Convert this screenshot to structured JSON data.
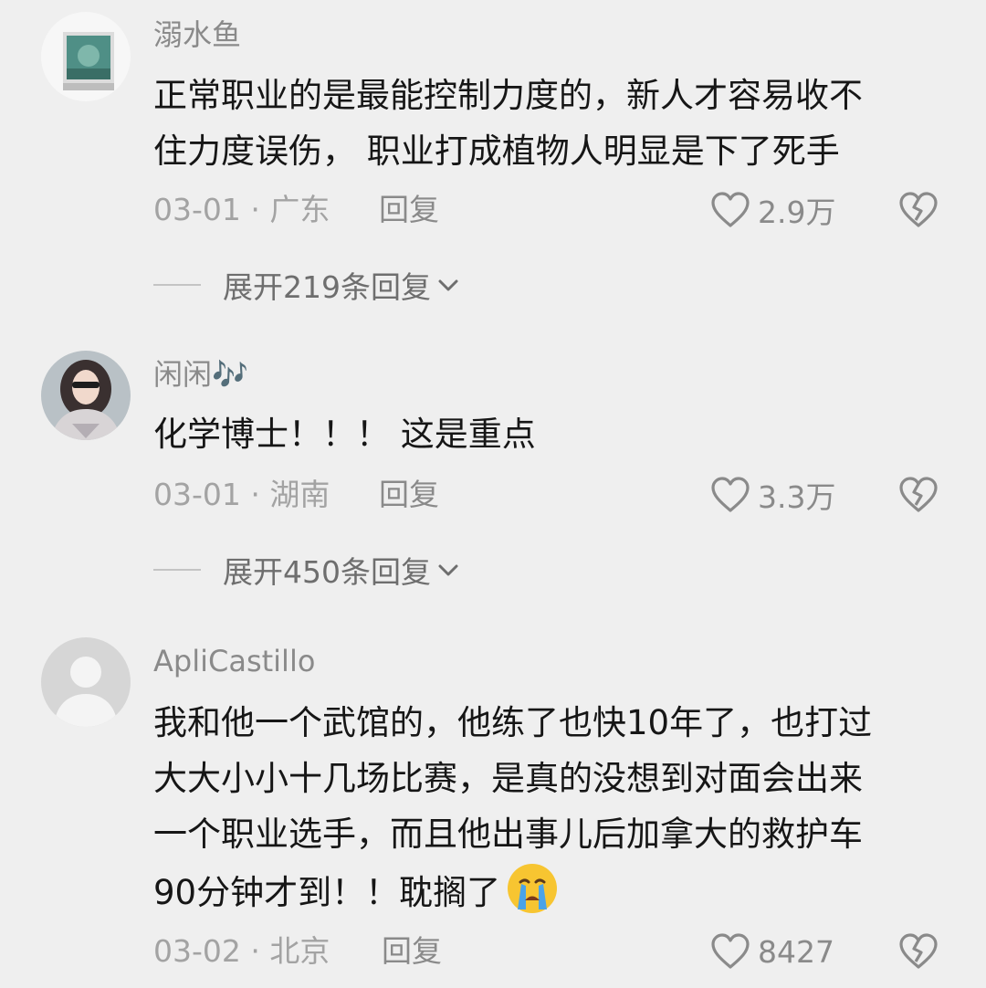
{
  "comments": [
    {
      "username": "溺水鱼",
      "lines": [
        "正常职业的是最能控制力度的，新人才容易收不",
        "住力度误伤， 职业打成植物人明显是下了死手"
      ],
      "date_location": "03-01 · 广东",
      "reply_label": "回复",
      "likes": "2.9万",
      "expand_label": "展开219条回复",
      "avatar_icon": "framed-photo-avatar"
    },
    {
      "username": "闲闲🎶",
      "lines": [
        "化学博士！！！ 这是重点"
      ],
      "date_location": "03-01 · 湖南",
      "reply_label": "回复",
      "likes": "3.3万",
      "expand_label": "展开450条回复",
      "avatar_icon": "girl-photo-avatar"
    },
    {
      "username": "ApliCastillo",
      "lines": [
        "我和他一个武馆的，他练了也快10年了，也打过",
        "大大小小十几场比赛，是真的没想到对面会出来",
        "一个职业选手，而且他出事儿后加拿大的救护车",
        "90分钟才到！！耽搁了"
      ],
      "date_location": "03-02 · 北京",
      "reply_label": "回复",
      "likes": "8427",
      "avatar_icon": "default-user-avatar",
      "emoji": "crying-face-emoji"
    }
  ],
  "colors": {
    "background": "#efefef",
    "text": "#161616",
    "secondary": "#8a8a8a",
    "muted": "#a3a3a3"
  }
}
